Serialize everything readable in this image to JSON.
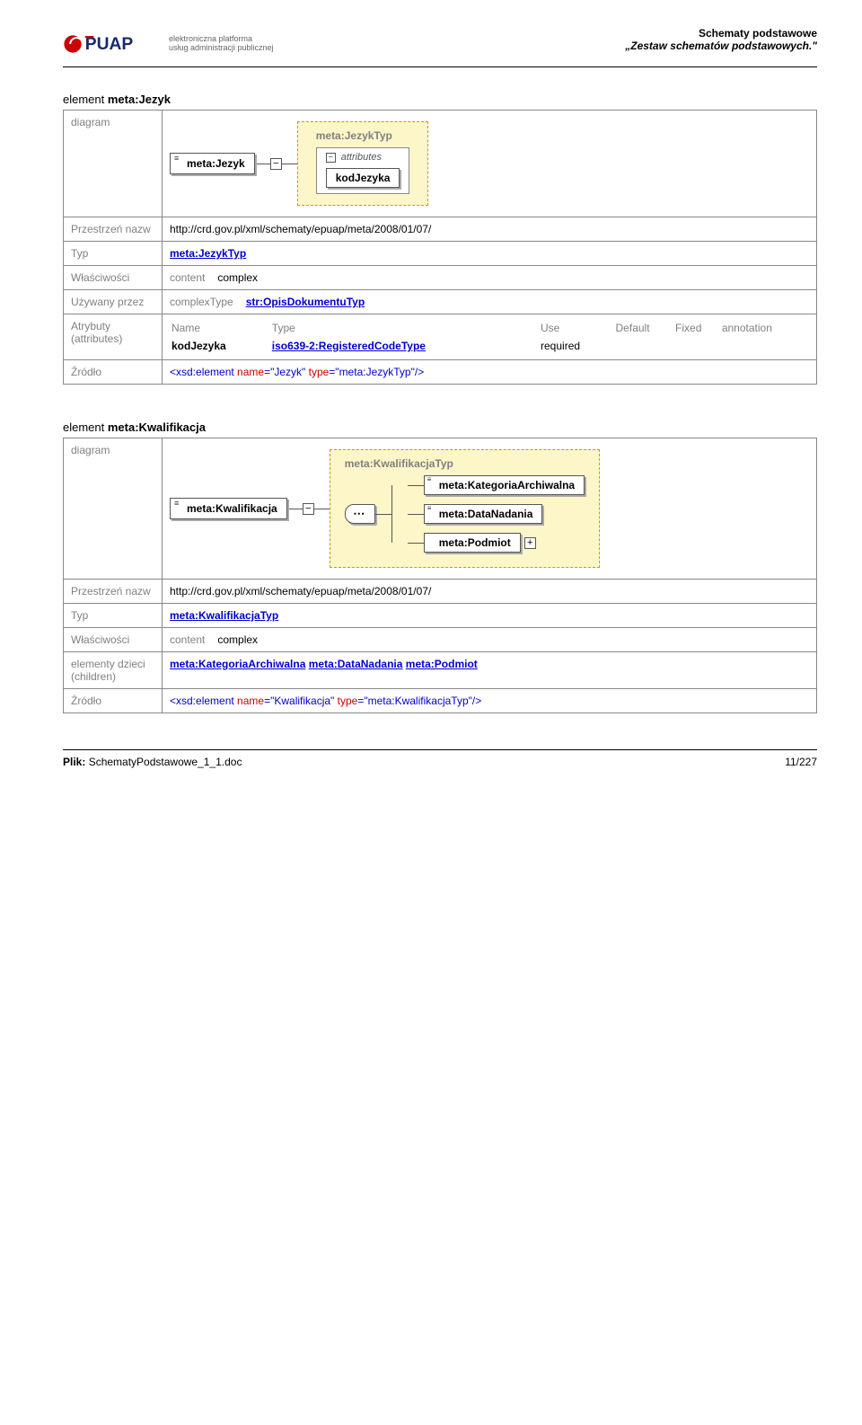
{
  "header": {
    "title": "Schematy podstawowe",
    "subtitle": "„Zestaw schematów podstawowych.\"",
    "logo_sub_line1": "elektroniczna platforma",
    "logo_sub_line2": "usług administracji publicznej"
  },
  "section1": {
    "prefix": "element ",
    "name": "meta:Jezyk",
    "diagram_label": "diagram",
    "diagram": {
      "root": "meta:Jezyk",
      "type_label": "meta:JezykTyp",
      "attributes_label": "attributes",
      "attr_item": "kodJezyka"
    },
    "rows": {
      "ns_label": "Przestrzeń nazw",
      "ns_value": "http://crd.gov.pl/xml/schematy/epuap/meta/2008/01/07/",
      "type_label": "Typ",
      "type_value": "meta:JezykTyp",
      "props_label": "Właściwości",
      "props_key": "content",
      "props_val": "complex",
      "usedby_label": "Używany przez",
      "usedby_key": "complexType",
      "usedby_val": "str:OpisDokumentuTyp",
      "attrs_label": "Atrybuty (attributes)",
      "attrs_headers": [
        "Name",
        "Type",
        "Use",
        "Default",
        "Fixed",
        "annotation"
      ],
      "attr_name": "kodJezyka",
      "attr_type": "iso639-2:RegisteredCodeType",
      "attr_use": "required",
      "source_label": "Źródło",
      "source": {
        "open": "<xsd:element",
        "a1n": " name",
        "a1v": "=\"Jezyk\"",
        "a2n": " type",
        "a2v": "=\"meta:JezykTyp\"",
        "close": "/>"
      }
    }
  },
  "section2": {
    "prefix": "element ",
    "name": "meta:Kwalifikacja",
    "diagram_label": "diagram",
    "diagram": {
      "root": "meta:Kwalifikacja",
      "type_label": "meta:KwalifikacjaTyp",
      "children": [
        "meta:KategoriaArchiwalna",
        "meta:DataNadania",
        "meta:Podmiot"
      ]
    },
    "rows": {
      "ns_label": "Przestrzeń nazw",
      "ns_value": "http://crd.gov.pl/xml/schematy/epuap/meta/2008/01/07/",
      "type_label": "Typ",
      "type_value": "meta:KwalifikacjaTyp",
      "props_label": "Właściwości",
      "props_key": "content",
      "props_val": "complex",
      "children_label": "elementy dzieci (children)",
      "children_links": [
        "meta:KategoriaArchiwalna",
        "meta:DataNadania",
        "meta:Podmiot"
      ],
      "source_label": "Źródło",
      "source": {
        "open": "<xsd:element",
        "a1n": " name",
        "a1v": "=\"Kwalifikacja\"",
        "a2n": " type",
        "a2v": "=\"meta:KwalifikacjaTyp\"",
        "close": "/>"
      }
    }
  },
  "footer": {
    "file_label": "Plik:",
    "file_name": "SchematyPodstawowe_1_1.doc",
    "page": "11/227"
  }
}
